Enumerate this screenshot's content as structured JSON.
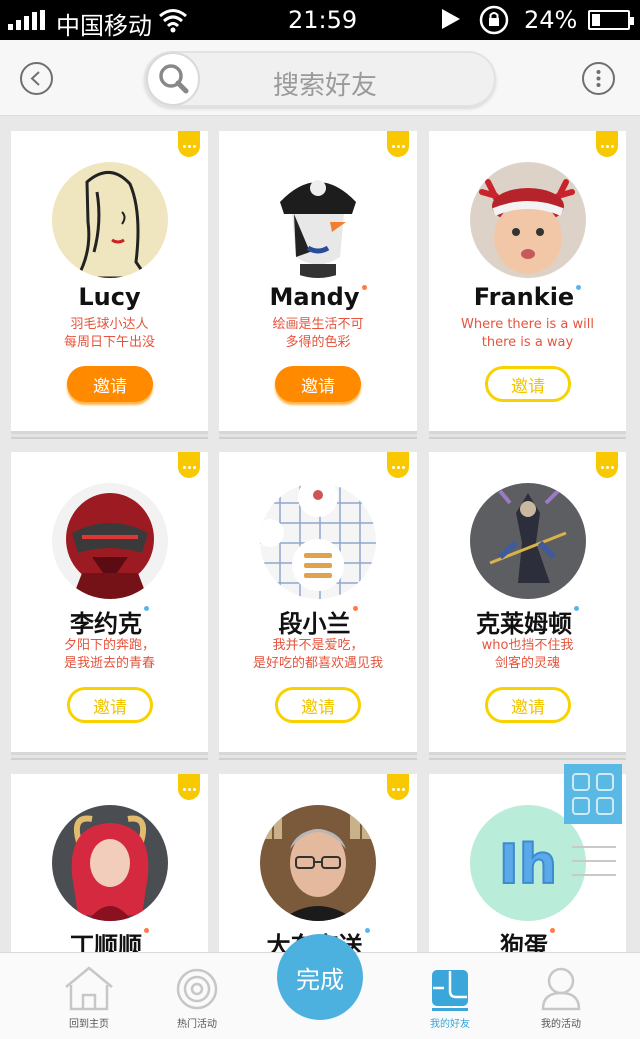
{
  "status_bar": {
    "carrier": "中国移动",
    "time": "21:59",
    "battery": "24%",
    "battery_level": 0.24
  },
  "search": {
    "placeholder": "搜索好友"
  },
  "friends": [
    {
      "name": "Lucy",
      "bio1": "羽毛球小达人",
      "bio2": "每周日下午出没",
      "invite": "邀请",
      "invite_style": "filled",
      "dot": ""
    },
    {
      "name": "Mandy",
      "bio1": "绘画是生活不可",
      "bio2": "多得的色彩",
      "invite": "邀请",
      "invite_style": "filled",
      "dot": "#ff7a45"
    },
    {
      "name": "Frankie",
      "bio1": "Where there is a will",
      "bio2": "there is a way",
      "invite": "邀请",
      "invite_style": "outline",
      "dot": "#5ab6e6"
    },
    {
      "name": "李约克",
      "bio1": "夕阳下的奔跑，",
      "bio2": "是我逝去的青春",
      "invite": "邀请",
      "invite_style": "outline",
      "dot": "#5ab6e6"
    },
    {
      "name": "段小兰",
      "bio1": "我并不是爱吃，",
      "bio2": "是好吃的都喜欢遇见我",
      "invite": "邀请",
      "invite_style": "outline",
      "dot": "#ff7a45"
    },
    {
      "name": "克莱姆顿",
      "bio1": "who也挡不住我",
      "bio2": "剑客的灵魂",
      "invite": "邀请",
      "invite_style": "outline",
      "dot": "#5ab6e6"
    },
    {
      "name": "丁顺顺",
      "bio1": "",
      "bio2": "",
      "invite": "",
      "invite_style": "outline",
      "dot": "#ff7a45"
    },
    {
      "name": "大东京送",
      "bio1": "",
      "bio2": "",
      "invite": "",
      "invite_style": "outline",
      "dot": "#5ab6e6"
    },
    {
      "name": "狗蛋",
      "bio1": "",
      "bio2": "",
      "invite": "",
      "invite_style": "outline",
      "dot": "#ff7a45"
    }
  ],
  "avatar9_text": "Ih",
  "nav": {
    "home": "回到主页",
    "events": "热门活动",
    "done": "完成",
    "friends": "我的好友",
    "my_events": "我的活动"
  },
  "icons": [
    "back-icon",
    "search-icon",
    "more-icon",
    "grid-icon",
    "list-icon",
    "home-icon",
    "target-icon",
    "friends-icon",
    "user-icon"
  ],
  "colors": {
    "accent_blue": "#4db1e0",
    "invite_orange": "#ff8a00",
    "invite_yellow": "#f8d200",
    "bio_red": "#e5543d"
  }
}
